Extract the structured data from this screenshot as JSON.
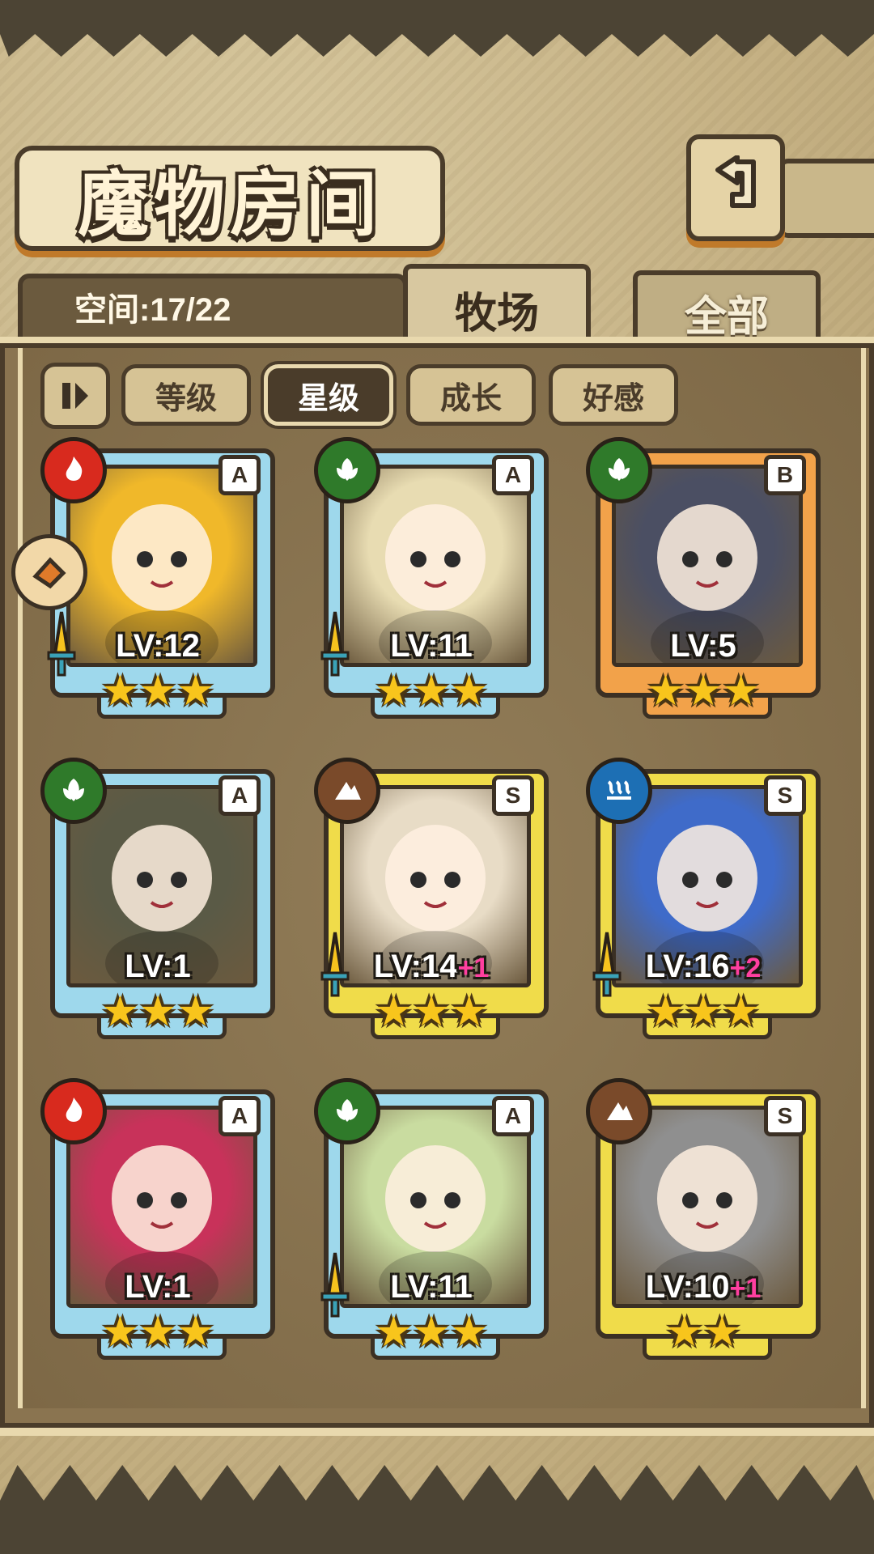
{
  "header": {
    "title": "魔物房间",
    "back_icon": "return-arrow-icon"
  },
  "capacity": {
    "text": "空间:17/22"
  },
  "tabs": [
    {
      "label": "牧场",
      "active": true
    },
    {
      "label": "全部",
      "active": false
    }
  ],
  "filters": {
    "sort_icon": "sort-toggle-icon",
    "items": [
      {
        "label": "等级",
        "active": false
      },
      {
        "label": "星级",
        "active": true
      },
      {
        "label": "成长",
        "active": false
      },
      {
        "label": "好感",
        "active": false
      }
    ]
  },
  "cards": [
    {
      "element": "fire",
      "rank": "A",
      "lv": "LV:12",
      "bonus": "",
      "stars": 3,
      "frame": "blue",
      "sword": true,
      "art": "#f0b82a"
    },
    {
      "element": "grass",
      "rank": "A",
      "lv": "LV:11",
      "bonus": "",
      "stars": 3,
      "frame": "blue",
      "sword": true,
      "art": "#e8dcb2"
    },
    {
      "element": "grass",
      "rank": "B",
      "lv": "LV:5",
      "bonus": "",
      "stars": 3,
      "frame": "orange",
      "sword": false,
      "art": "#4b4f63"
    },
    {
      "element": "grass",
      "rank": "A",
      "lv": "LV:1",
      "bonus": "",
      "stars": 3,
      "frame": "blue",
      "sword": false,
      "art": "#5a5a46"
    },
    {
      "element": "earth",
      "rank": "S",
      "lv": "LV:14",
      "bonus": "+1",
      "stars": 3,
      "frame": "yellow",
      "sword": true,
      "art": "#e8dcc6"
    },
    {
      "element": "water",
      "rank": "S",
      "lv": "LV:16",
      "bonus": "+2",
      "stars": 3,
      "frame": "yellow",
      "sword": true,
      "art": "#3f6bc9"
    },
    {
      "element": "fire",
      "rank": "A",
      "lv": "LV:1",
      "bonus": "",
      "stars": 3,
      "frame": "blue",
      "sword": false,
      "art": "#c8325a"
    },
    {
      "element": "grass",
      "rank": "A",
      "lv": "LV:11",
      "bonus": "",
      "stars": 3,
      "frame": "blue",
      "sword": true,
      "art": "#c9dca0"
    },
    {
      "element": "earth",
      "rank": "S",
      "lv": "LV:10",
      "bonus": "+1",
      "stars": 2,
      "frame": "yellow",
      "sword": false,
      "art": "#8f8f8f"
    }
  ]
}
